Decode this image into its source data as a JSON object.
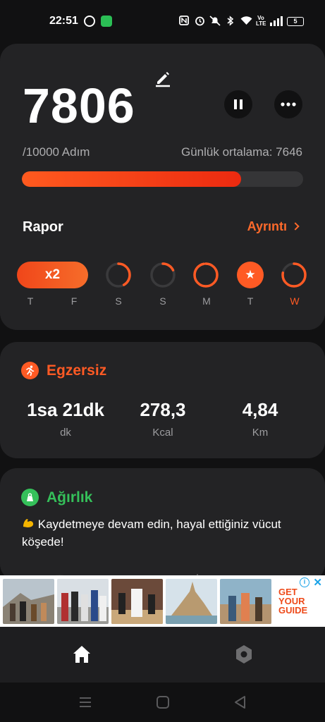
{
  "status_bar": {
    "time": "22:51",
    "battery": "5",
    "icons": [
      "whatsapp-icon",
      "app-notification-icon",
      "nfc-icon",
      "alarm-icon",
      "mute-icon",
      "bluetooth-icon",
      "wifi-icon",
      "volte-icon",
      "signal-icon",
      "battery-icon"
    ]
  },
  "steps": {
    "count": "7806",
    "goal": "/10000 Adım",
    "daily_average": "Günlük ortalama: 7646",
    "progress_fraction": 0.7806
  },
  "report": {
    "title": "Rapor",
    "details_link": "Ayrıntı",
    "streak_label": "x2",
    "days": [
      {
        "label": "T",
        "state": "streak",
        "progress": 1.0
      },
      {
        "label": "F",
        "state": "streak",
        "progress": 1.0
      },
      {
        "label": "S",
        "state": "ring",
        "progress": 0.42
      },
      {
        "label": "S",
        "state": "ring",
        "progress": 0.18
      },
      {
        "label": "M",
        "state": "ring",
        "progress": 0.97
      },
      {
        "label": "T",
        "state": "star",
        "progress": 1.0
      },
      {
        "label": "W",
        "state": "today",
        "progress": 0.78
      }
    ]
  },
  "exercise": {
    "title": "Egzersiz",
    "metrics": [
      {
        "value": "1sa 21dk",
        "unit": "dk"
      },
      {
        "value": "278,3",
        "unit": "Kcal"
      },
      {
        "value": "4,84",
        "unit": "Km"
      }
    ]
  },
  "weight": {
    "title": "Ağırlık",
    "message": "Kaydetmeye devam edin, hayal ettiğiniz vücut köşede!"
  },
  "ad": {
    "copy_lines": [
      "GET",
      "YOUR",
      "GUIDE"
    ]
  },
  "bottom_nav": {
    "items": [
      "home-icon",
      "settings-icon"
    ]
  },
  "colors": {
    "accent_orange": "#ff5a24",
    "accent_green": "#35c05a",
    "card_bg": "#232325",
    "page_bg": "#111112"
  }
}
